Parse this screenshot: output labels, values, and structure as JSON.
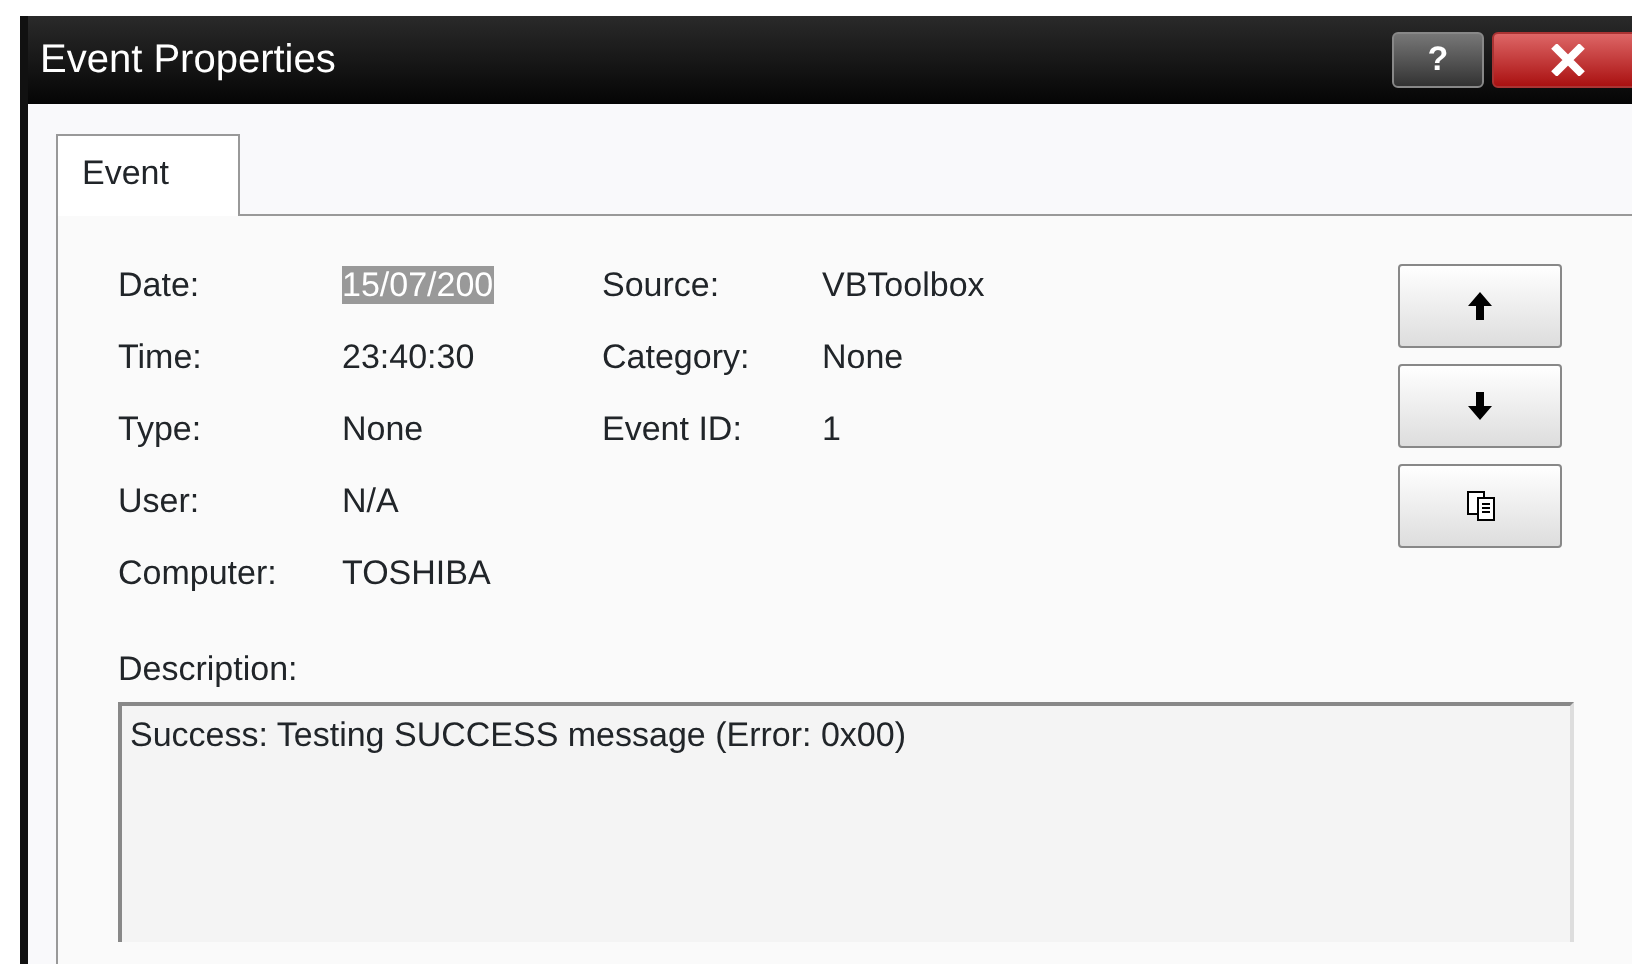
{
  "window": {
    "title": "Event Properties",
    "help_button": "?"
  },
  "tabs": [
    {
      "label": "Event",
      "selected": true
    }
  ],
  "details": {
    "left": [
      {
        "label": "Date:",
        "value": "15/07/200",
        "selected": true
      },
      {
        "label": "Time:",
        "value": "23:40:30",
        "selected": false
      },
      {
        "label": "Type:",
        "value": "None",
        "selected": false
      },
      {
        "label": "User:",
        "value": "N/A",
        "selected": false
      },
      {
        "label": "Computer:",
        "value": "TOSHIBA",
        "selected": false
      }
    ],
    "right": [
      {
        "label": "Source:",
        "value": "VBToolbox"
      },
      {
        "label": "Category:",
        "value": "None"
      },
      {
        "label": "Event ID:",
        "value": "1"
      }
    ]
  },
  "side_buttons": [
    {
      "kind": "up"
    },
    {
      "kind": "down"
    },
    {
      "kind": "copy"
    }
  ],
  "description": {
    "label": "Description:",
    "text": "Success: Testing SUCCESS message (Error: 0x00)"
  }
}
